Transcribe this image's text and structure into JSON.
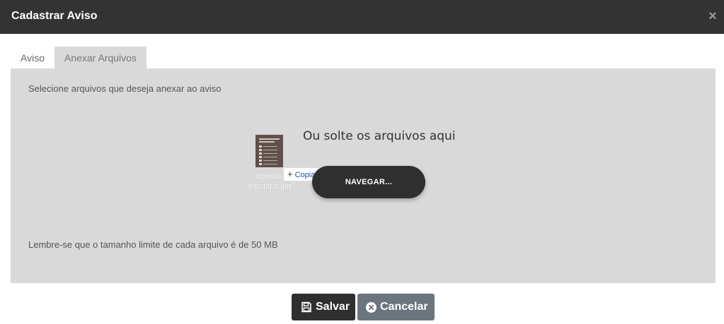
{
  "header": {
    "title": "Cadastrar Aviso",
    "close_symbol": "×"
  },
  "tabs": [
    {
      "label": "Aviso",
      "active": false
    },
    {
      "label": "Anexar Arquivos",
      "active": true
    }
  ],
  "attach": {
    "instruction": "Selecione arquivos que deseja anexar ao aviso",
    "drop_text": "Ou solte os arquivos aqui",
    "browse_label": "NAVEGAR...",
    "size_limit_note": "Lembre-se que o tamanho limite de cada arquivo é de 50 MB",
    "dragged_file": {
      "name": "agenda-tributaria.jpg",
      "icon": "image-file-icon"
    },
    "drag_tooltip": {
      "label": "Copiar",
      "icon": "plus-icon"
    }
  },
  "footer": {
    "save_label": "Salvar",
    "cancel_label": "Cancelar"
  },
  "colors": {
    "header_bg": "#333333",
    "panel_bg": "#d9d9d9",
    "primary_dark": "#2f2f2f",
    "secondary": "#6c757d"
  }
}
